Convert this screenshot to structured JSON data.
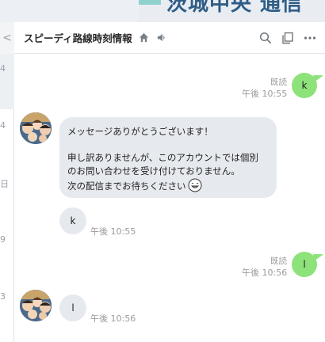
{
  "header": {
    "title": "スピーディ路線時刻情報",
    "back_label": "<",
    "home_icon": "home-icon",
    "mute_icon": "speaker-icon",
    "search_icon": "search-icon",
    "notes_icon": "notes-icon",
    "more_icon": "more-icon"
  },
  "sidebar": {
    "row_labels": [
      "4",
      "4",
      "日",
      "9",
      "3"
    ]
  },
  "background_window": {
    "text": "茨城中央 通信"
  },
  "messages": [
    {
      "side": "mine",
      "text": "k",
      "read": "既読",
      "time": "午後 10:55"
    },
    {
      "side": "theirs",
      "lines": [
        "メッセージありがとうございます！",
        "",
        "申し訳ありませんが、このアカウントでは個別",
        "のお問い合わせを受け付けておりません。",
        "次の配信までお待ちください"
      ],
      "emoji": "smile-emoji-icon"
    },
    {
      "side": "theirs",
      "text": "k",
      "time": "午後 10:55"
    },
    {
      "side": "mine",
      "text": "l",
      "read": "既読",
      "time": "午後 10:56"
    },
    {
      "side": "theirs",
      "text": "l",
      "time": "午後 10:56"
    }
  ],
  "colors": {
    "mine_bubble": "#8de27a",
    "their_bubble": "#e6e9ee",
    "header_bg": "#ffffff",
    "time_text": "#9a9a9a"
  }
}
